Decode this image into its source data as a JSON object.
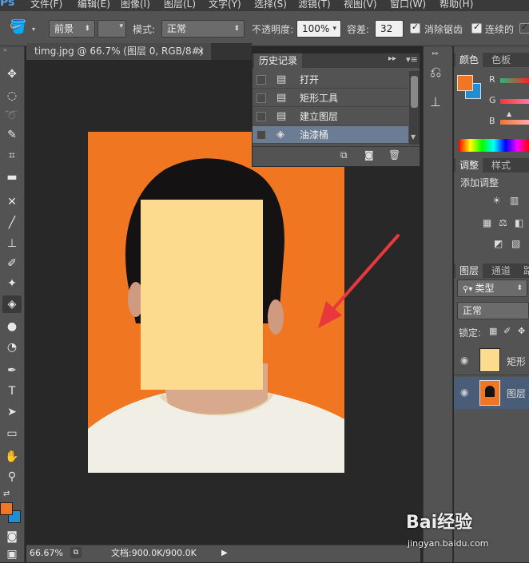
{
  "app": {
    "logo": "Ps"
  },
  "menu": [
    "文件(F)",
    "编辑(E)",
    "图像(I)",
    "图层(L)",
    "文字(Y)",
    "选择(S)",
    "滤镜(T)",
    "视图(V)",
    "窗口(W)",
    "帮助(H)"
  ],
  "options": {
    "fill_source": "前景",
    "mode_label": "模式:",
    "mode_value": "正常",
    "opacity_label": "不透明度:",
    "opacity_value": "100%",
    "tolerance_label": "容差:",
    "tolerance_value": "32",
    "antialias_label": "消除锯齿",
    "contiguous_label": "连续的"
  },
  "document": {
    "tab_title": "timg.jpg @ 66.7% (图层 0, RGB/8#) *",
    "close_glyph": "×",
    "zoom": "66.67%",
    "doc_info": "文档:900.0K/900.0K"
  },
  "history": {
    "title": "历史记录",
    "items": [
      "打开",
      "矩形工具",
      "建立图层",
      "油漆桶"
    ],
    "active_index": 3
  },
  "color_panel": {
    "tabs": [
      "颜色",
      "色板"
    ],
    "channels": [
      "R",
      "G",
      "B"
    ],
    "fg_color": "#f07622",
    "bg_color": "#1e8fd6"
  },
  "adjust_panel": {
    "tabs": [
      "调整",
      "样式"
    ],
    "add_label": "添加调整"
  },
  "layers_panel": {
    "tabs": [
      "图层",
      "通道",
      "路"
    ],
    "filter": "类型",
    "blend": "正常",
    "lock_label": "锁定:",
    "layers": [
      {
        "name": "矩形"
      },
      {
        "name": "图层"
      }
    ]
  },
  "colors": {
    "photo_bg": "#f07622",
    "face_rect": "#fddb8e",
    "arrow": "#e8383d"
  },
  "watermark": {
    "brand": "Bai经验",
    "url": "jingyan.baidu.com"
  }
}
